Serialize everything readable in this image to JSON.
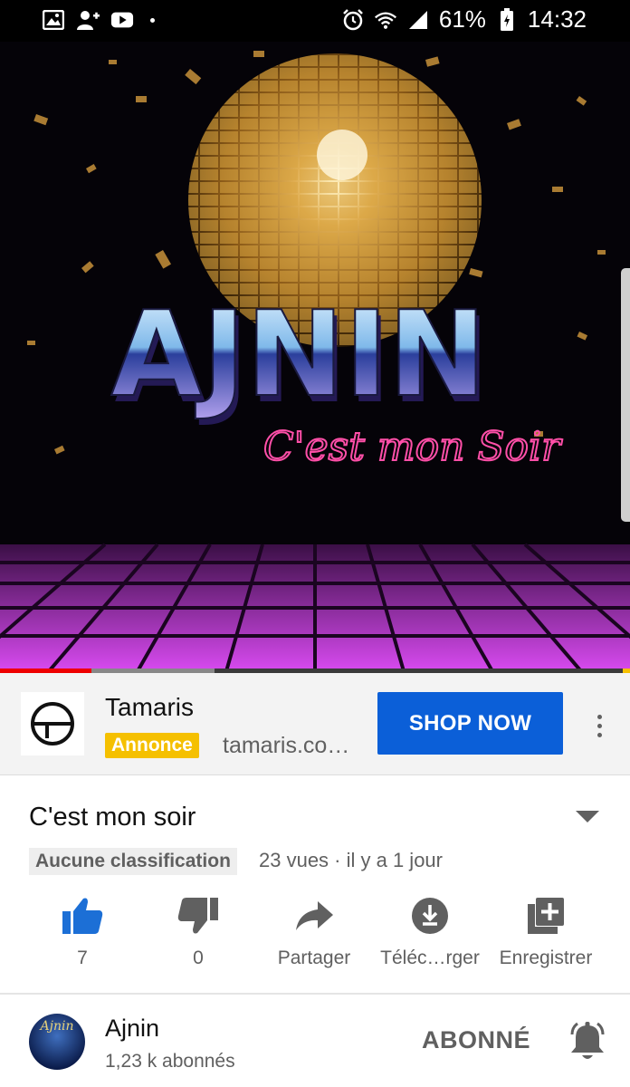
{
  "status_bar": {
    "left_icons": [
      "image-icon",
      "add-contact-icon",
      "youtube-icon"
    ],
    "battery_percent": "61%",
    "time": "14:32"
  },
  "video": {
    "artwork_title": "AJNIN",
    "artwork_subtitle": "C'est mon Soir",
    "progress": 0.145,
    "buffered": 0.34
  },
  "ad": {
    "advertiser": "Tamaris",
    "badge": "Annonce",
    "domain": "tamaris.co…",
    "cta": "SHOP NOW"
  },
  "info": {
    "title": "C'est mon soir",
    "rating": "Aucune classification",
    "views_meta": "23 vues · il y a 1 jour"
  },
  "actions": {
    "like_count": "7",
    "dislike_count": "0",
    "share": "Partager",
    "download": "Téléc…rger",
    "save": "Enregistrer"
  },
  "channel": {
    "avatar_text": "Ajnin",
    "name": "Ajnin",
    "subscribers": "1,23 k abonnés",
    "subscribe_state": "ABONNÉ"
  },
  "colors": {
    "accent_blue": "#0b5fd8",
    "like_blue": "#1c6fd6",
    "ad_yellow": "#f5c000",
    "progress_red": "#e00000",
    "neon_pink": "#ff4fa8",
    "floor_magenta": "#c23ad8"
  }
}
